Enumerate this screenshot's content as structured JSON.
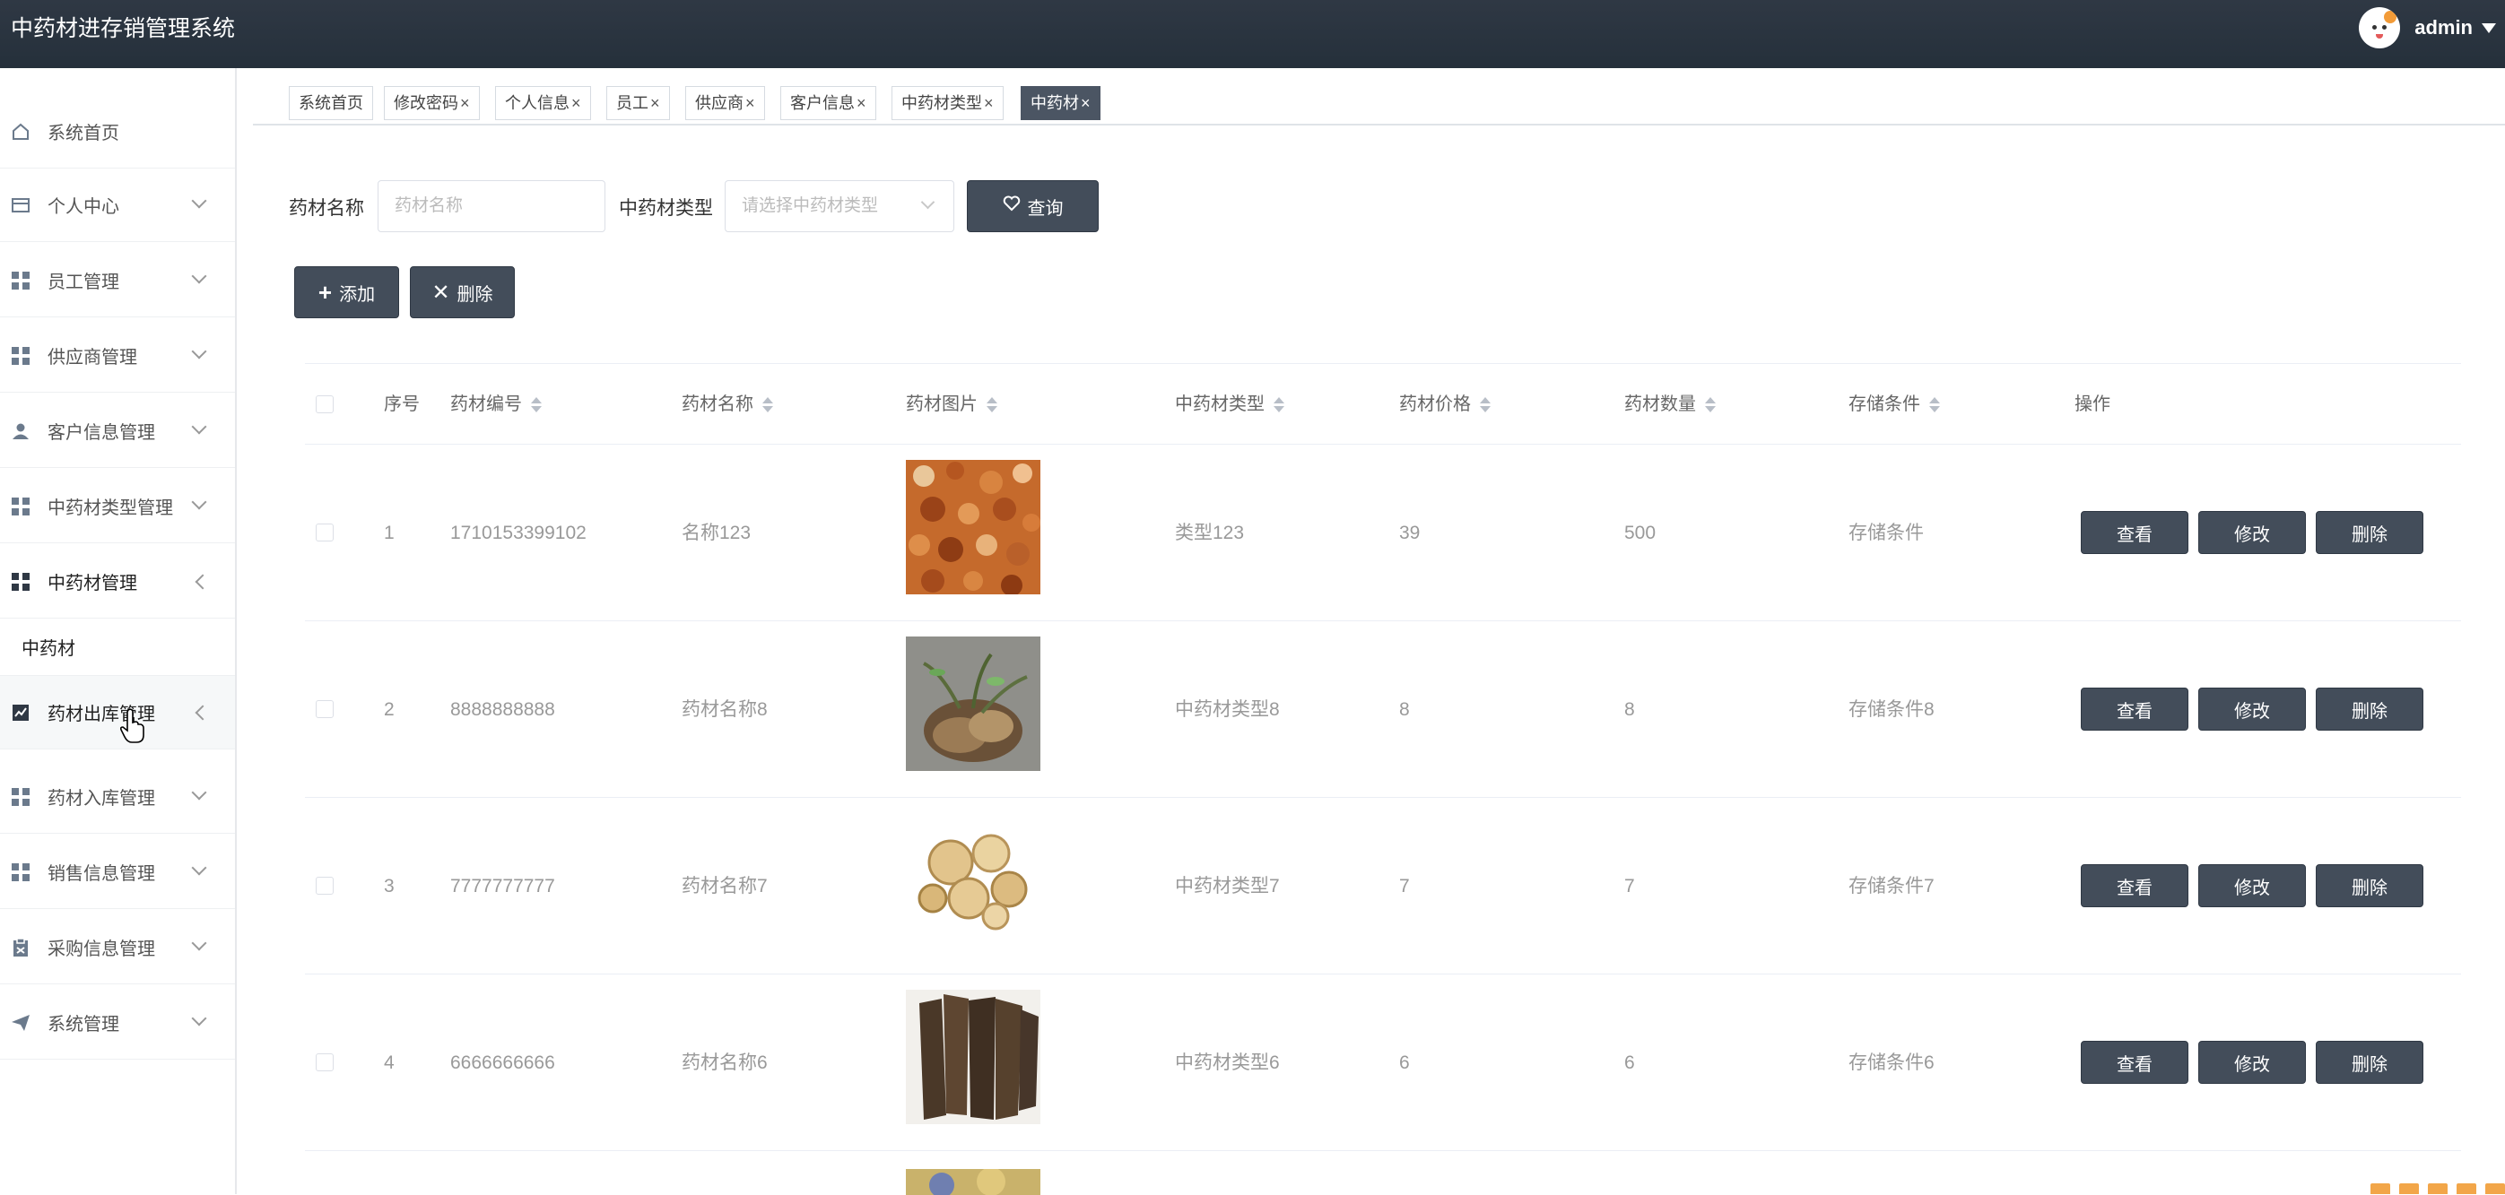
{
  "header": {
    "app_title": "中药材进存销管理系统",
    "user_name": "admin"
  },
  "sidebar": {
    "items": [
      {
        "label": "系统首页",
        "icon": "home-icon"
      },
      {
        "label": "个人中心",
        "icon": "id-card-icon"
      },
      {
        "label": "员工管理",
        "icon": "grid-icon"
      },
      {
        "label": "供应商管理",
        "icon": "grid-icon"
      },
      {
        "label": "客户信息管理",
        "icon": "user-icon"
      },
      {
        "label": "中药材类型管理",
        "icon": "grid-icon"
      },
      {
        "label": "中药材管理",
        "icon": "grid-icon"
      },
      {
        "label": "药材出库管理",
        "icon": "chart-icon"
      },
      {
        "label": "药材入库管理",
        "icon": "grid-icon"
      },
      {
        "label": "销售信息管理",
        "icon": "grid-icon"
      },
      {
        "label": "采购信息管理",
        "icon": "clipboard-icon"
      },
      {
        "label": "系统管理",
        "icon": "send-icon"
      }
    ],
    "submenu": {
      "label": "中药材"
    }
  },
  "tabs": [
    {
      "label": "系统首页"
    },
    {
      "label": "修改密码"
    },
    {
      "label": "个人信息"
    },
    {
      "label": "员工"
    },
    {
      "label": "供应商"
    },
    {
      "label": "客户信息"
    },
    {
      "label": "中药材类型"
    },
    {
      "label": "中药材"
    }
  ],
  "tab_close": "×",
  "search": {
    "name_label": "药材名称",
    "name_placeholder": "药材名称",
    "type_label": "中药材类型",
    "type_placeholder": "请选择中药材类型",
    "query_button": "查询"
  },
  "actions": {
    "add_button": "添加",
    "delete_button": "删除"
  },
  "table": {
    "columns": [
      "序号",
      "药材编号",
      "药材名称",
      "药材图片",
      "中药材类型",
      "药材价格",
      "药材数量",
      "存储条件",
      "操作"
    ],
    "rows": [
      {
        "index": "1",
        "code": "1710153399102",
        "name": "名称123",
        "type": "类型123",
        "price": "39",
        "quantity": "500",
        "storage": "存储条件"
      },
      {
        "index": "2",
        "code": "8888888888",
        "name": "药材名称8",
        "type": "中药材类型8",
        "price": "8",
        "quantity": "8",
        "storage": "存储条件8"
      },
      {
        "index": "3",
        "code": "7777777777",
        "name": "药材名称7",
        "type": "中药材类型7",
        "price": "7",
        "quantity": "7",
        "storage": "存储条件7"
      },
      {
        "index": "4",
        "code": "6666666666",
        "name": "药材名称6",
        "type": "中药材类型6",
        "price": "6",
        "quantity": "6",
        "storage": "存储条件6"
      }
    ],
    "row_buttons": {
      "view": "查看",
      "edit": "修改",
      "delete": "删除"
    }
  },
  "colors": {
    "header_bg": "#2f3844",
    "button_bg": "#434d5a",
    "active_tab": "#4b5563"
  }
}
